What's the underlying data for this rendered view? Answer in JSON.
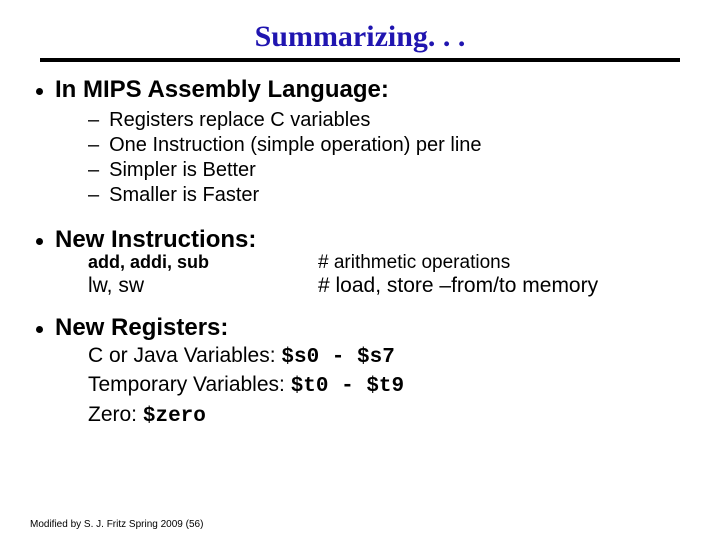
{
  "title": "Summarizing. . .",
  "section1": {
    "heading": "In MIPS Assembly Language:",
    "items": [
      "Registers replace C variables",
      "One Instruction (simple operation) per line",
      "Simpler is Better",
      "Smaller is Faster"
    ]
  },
  "section2": {
    "heading": "New Instructions:",
    "rows": [
      {
        "left": "add, addi, sub",
        "right": "# arithmetic operations"
      },
      {
        "left": "lw, sw",
        "right": "# load, store –from/to memory"
      }
    ]
  },
  "section3": {
    "heading": "New Registers:",
    "lines": {
      "c_java_label": "C  or Java  Variables: ",
      "c_java_range_a": "$s0",
      "c_java_sep": " - ",
      "c_java_range_b": "$s7",
      "temp_label": "Temporary Variables: ",
      "temp_range_a": "$t0",
      "temp_sep": " - ",
      "temp_range_b": "$t9",
      "zero_label": "Zero: ",
      "zero_val": "$zero"
    }
  },
  "footer": "Modified by  S. J. Fritz  Spring 2009 (56)",
  "dash": "–"
}
